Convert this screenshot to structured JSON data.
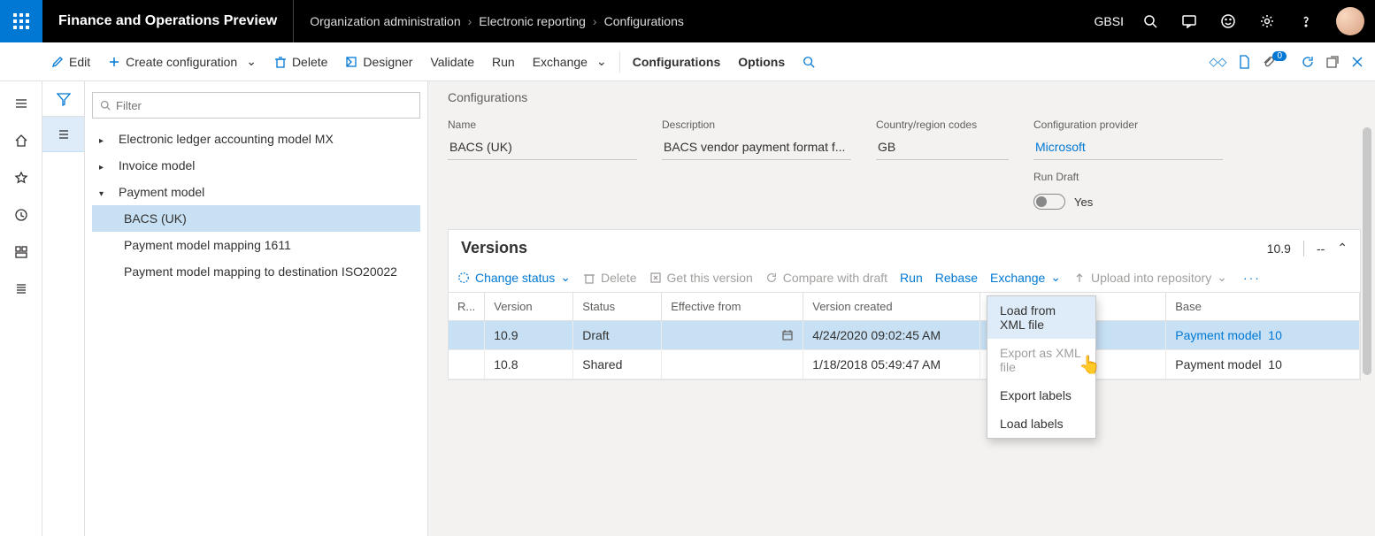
{
  "header": {
    "app_title": "Finance and Operations Preview",
    "breadcrumb": [
      "Organization administration",
      "Electronic reporting",
      "Configurations"
    ],
    "user_label": "GBSI"
  },
  "cmdbar": {
    "edit": "Edit",
    "create": "Create configuration",
    "delete": "Delete",
    "designer": "Designer",
    "validate": "Validate",
    "run": "Run",
    "exchange": "Exchange",
    "configurations": "Configurations",
    "options": "Options",
    "badge": "0"
  },
  "filter": {
    "placeholder": "Filter"
  },
  "tree": {
    "items": [
      {
        "label": "Electronic ledger accounting model MX",
        "expanded": false
      },
      {
        "label": "Invoice model",
        "expanded": false
      },
      {
        "label": "Payment model",
        "expanded": true,
        "children": [
          {
            "label": "BACS (UK)",
            "selected": true
          },
          {
            "label": "Payment model mapping 1611"
          },
          {
            "label": "Payment model mapping to destination ISO20022"
          }
        ]
      }
    ]
  },
  "details": {
    "section": "Configurations",
    "name_label": "Name",
    "name": "BACS (UK)",
    "desc_label": "Description",
    "desc": "BACS vendor payment format f...",
    "country_label": "Country/region codes",
    "country": "GB",
    "provider_label": "Configuration provider",
    "provider": "Microsoft",
    "rundraft_label": "Run Draft",
    "rundraft_value": "Yes"
  },
  "versions": {
    "title": "Versions",
    "header_right_version": "10.9",
    "header_right_dash": "--",
    "toolbar": {
      "change_status": "Change status",
      "delete": "Delete",
      "get": "Get this version",
      "compare": "Compare with draft",
      "run": "Run",
      "rebase": "Rebase",
      "exchange": "Exchange",
      "upload": "Upload into repository"
    },
    "columns": {
      "r": "R...",
      "version": "Version",
      "status": "Status",
      "effective": "Effective from",
      "created": "Version created",
      "base": "Base"
    },
    "rows": [
      {
        "version": "10.9",
        "status": "Draft",
        "effective": "",
        "created": "4/24/2020 09:02:45 AM",
        "base_name": "Payment model",
        "base_ver": "10",
        "selected": true
      },
      {
        "version": "10.8",
        "status": "Shared",
        "effective": "",
        "created": "1/18/2018 05:49:47 AM",
        "base_name": "Payment model",
        "base_ver": "10",
        "selected": false
      }
    ]
  },
  "exchange_menu": {
    "load_xml": "Load from XML file",
    "export_xml": "Export as XML file",
    "export_labels": "Export labels",
    "load_labels": "Load labels"
  }
}
